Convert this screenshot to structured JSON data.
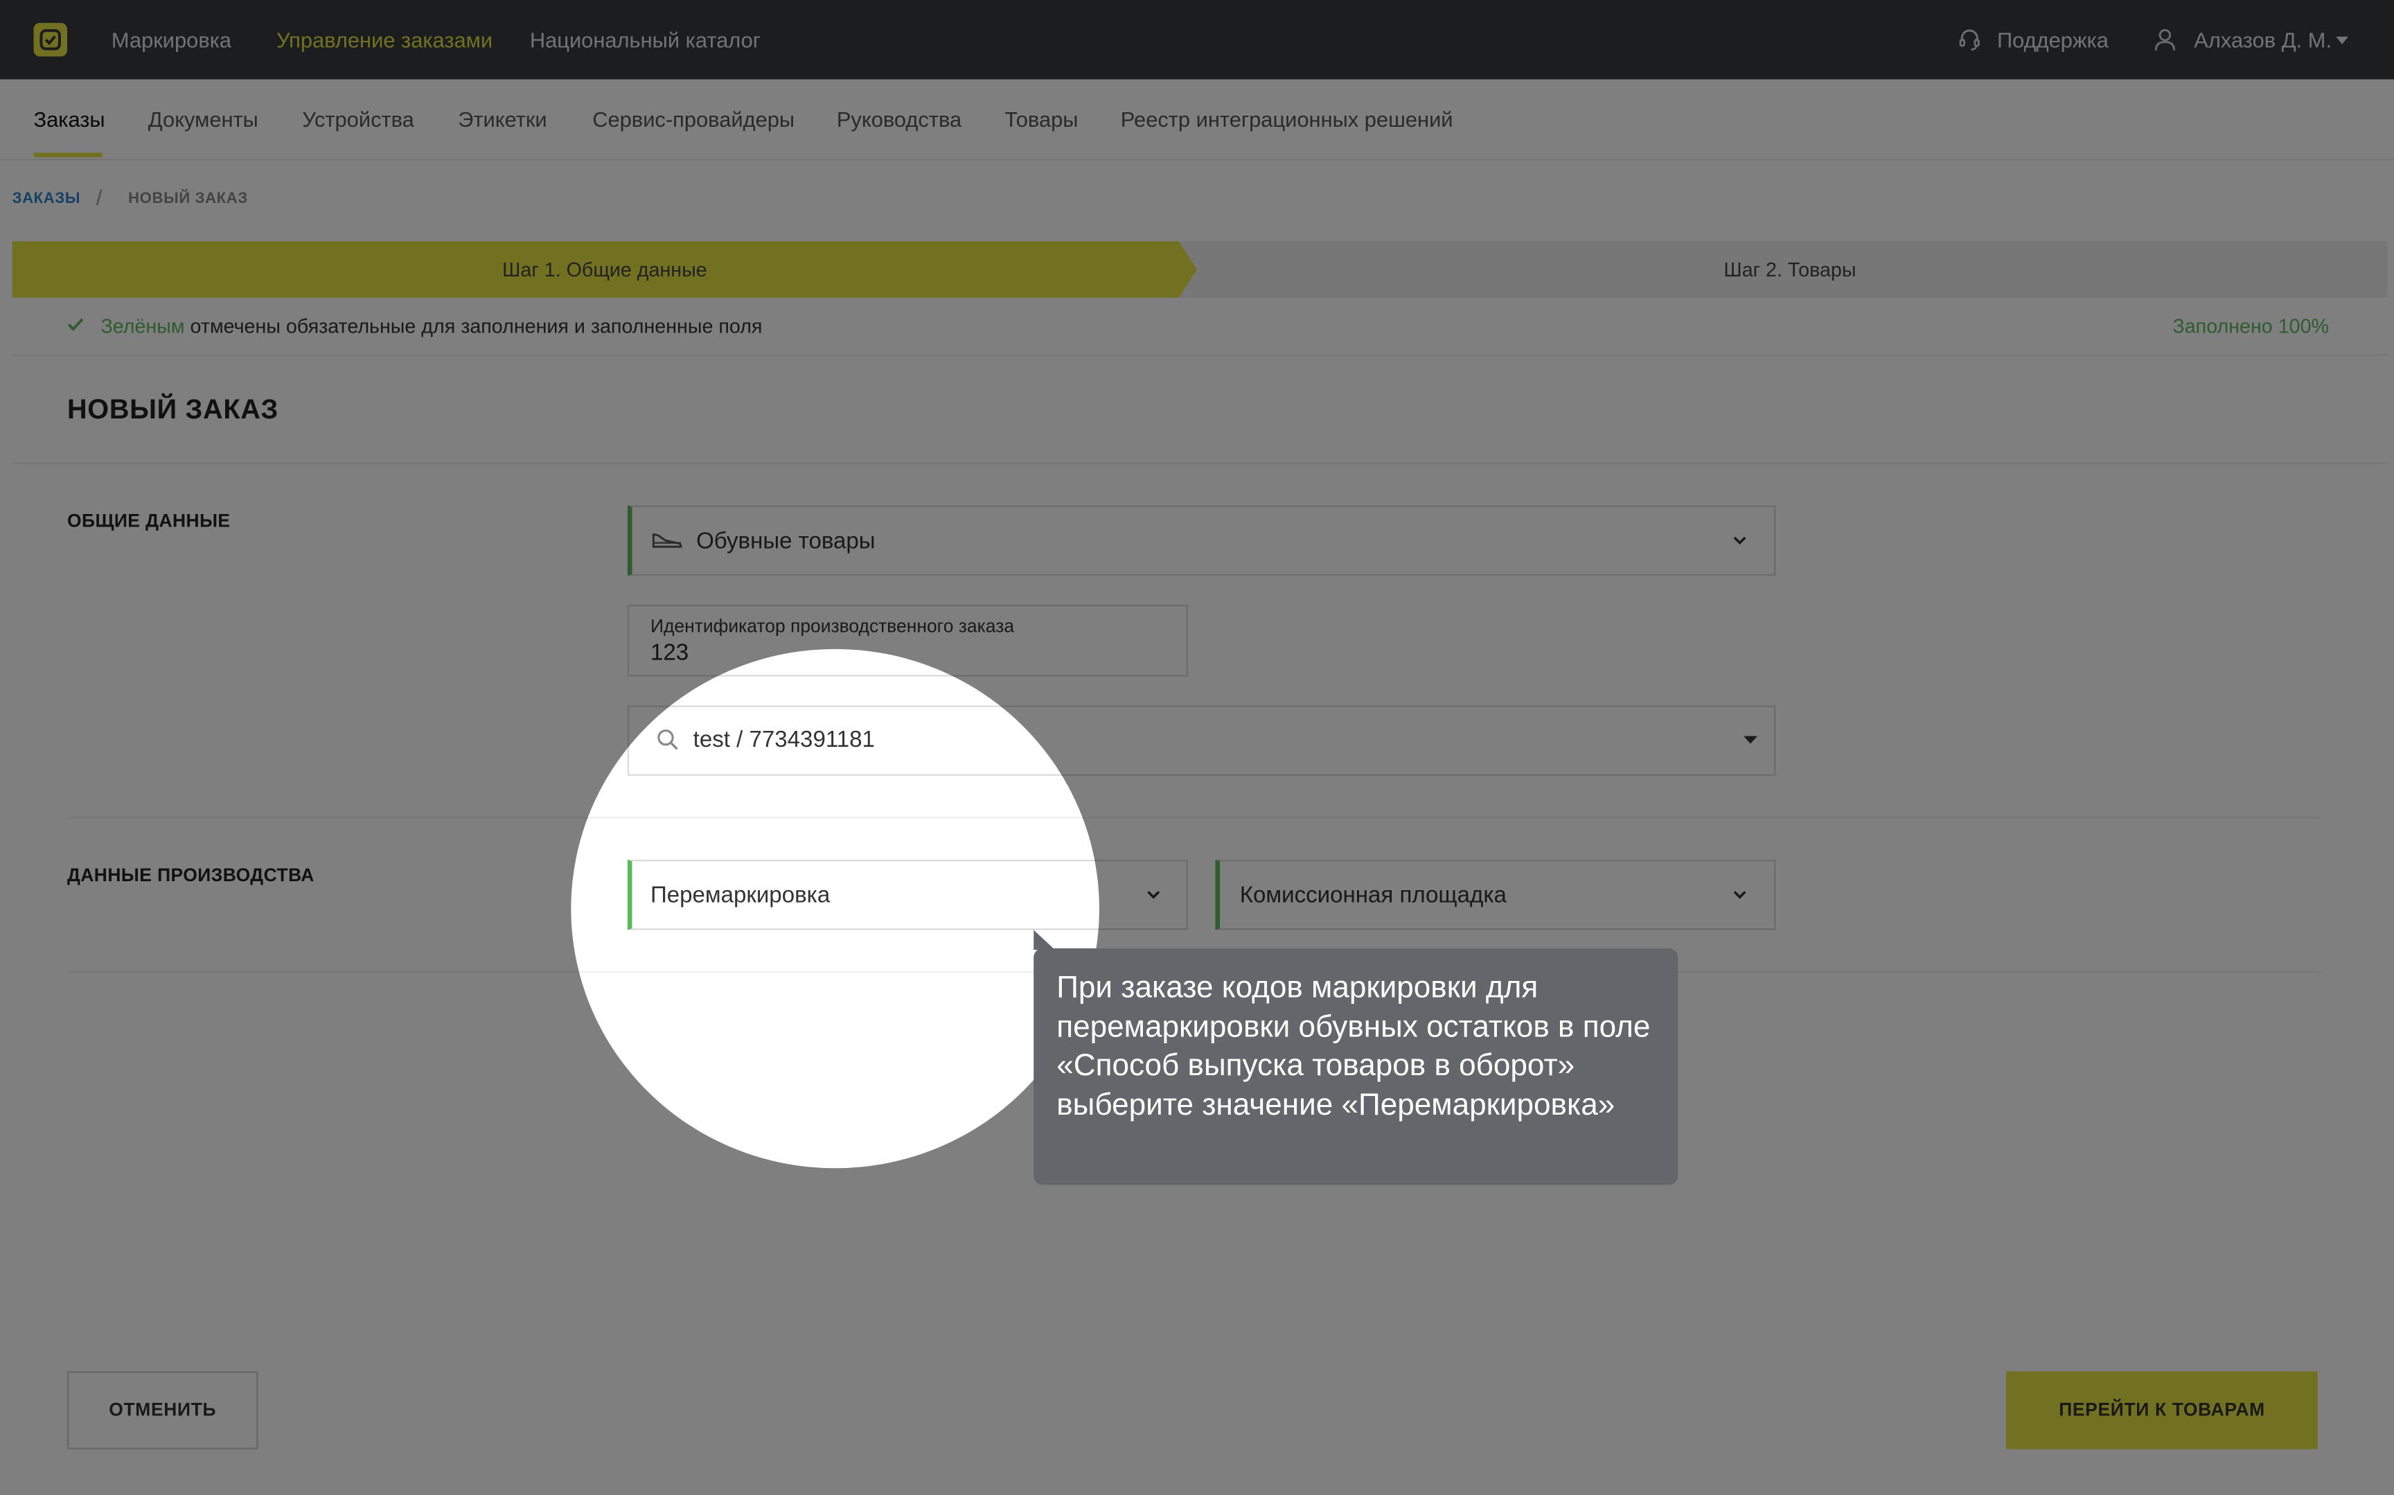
{
  "topbar": {
    "nav": [
      "Маркировка",
      "Управление заказами",
      "Национальный каталог"
    ],
    "support": "Поддержка",
    "user": "Алхазов Д. М."
  },
  "subnav": {
    "tabs": [
      "Заказы",
      "Документы",
      "Устройства",
      "Этикетки",
      "Сервис-провайдеры",
      "Руководства",
      "Товары",
      "Реестр интеграционных решений"
    ]
  },
  "breadcrumb": {
    "root": "ЗАКАЗЫ",
    "current": "НОВЫЙ ЗАКАЗ"
  },
  "steps": {
    "step1": "Шаг 1. Общие данные",
    "step2": "Шаг 2. Товары"
  },
  "hint": {
    "green_word": "Зелёным",
    "rest": " отмечены обязательные для заполнения и заполненные поля",
    "filled": "Заполнено 100%"
  },
  "page_title": "НОВЫЙ ЗАКАЗ",
  "general": {
    "label": "ОБЩИЕ ДАННЫЕ",
    "product_group": "Обувные товары",
    "order_id_label": "Идентификатор производственного заказа",
    "order_id_value": "123",
    "company": "test / 7734391181"
  },
  "production": {
    "label": "ДАННЫЕ ПРОИЗВОДСТВА",
    "release_method": "Перемаркировка",
    "platform": "Комиссионная площадка"
  },
  "buttons": {
    "cancel": "ОТМЕНИТЬ",
    "next": "ПЕРЕЙТИ К ТОВАРАМ"
  },
  "tooltip": "При заказе кодов маркировки для перемаркировки обувных остатков в поле «Способ выпуска товаров в оборот» выберите значение «Перемаркировка»",
  "colors": {
    "accent": "#e4e142",
    "valid": "#5cb85c",
    "topbar": "#363a3f"
  }
}
